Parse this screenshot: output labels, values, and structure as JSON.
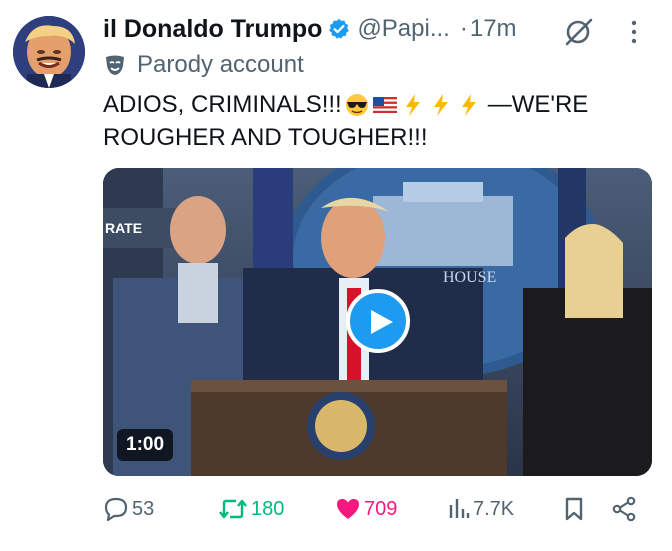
{
  "author": {
    "display_name": "il Donaldo Trumpo",
    "handle": "@Papi...",
    "separator": "·",
    "time": "17m",
    "label": "Parody account",
    "verified": true
  },
  "tweet": {
    "text_line1_start": "ADIOS, CRIMINALS!!!",
    "text_line1_end": "—WE'RE",
    "text_line2": "ROUGHER AND TOUGHER!!!",
    "emojis": [
      "sunglasses-emoji",
      "us-flag-emoji",
      "lightning-emoji",
      "lightning-emoji",
      "lightning-emoji"
    ]
  },
  "media": {
    "type": "video",
    "duration": "1:00",
    "background_text": {
      "left_sign": "RATE",
      "right_sign": "HOUSE"
    }
  },
  "actions": {
    "replies": "53",
    "reposts": "180",
    "likes": "709",
    "views": "7.7K"
  },
  "colors": {
    "text_primary": "#0f1419",
    "text_secondary": "#536471",
    "verified_blue": "#1d9bf0",
    "repost_green": "#00ba7c",
    "like_pink": "#f91880"
  }
}
